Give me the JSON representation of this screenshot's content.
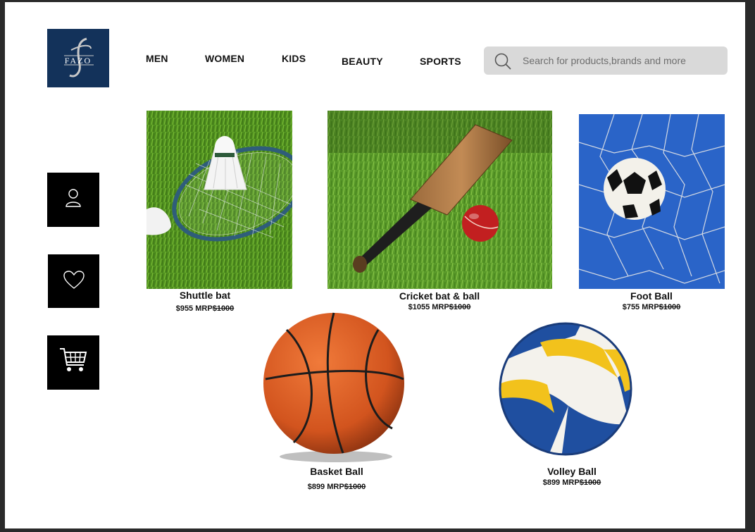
{
  "brand": {
    "logo_text": "FAZO",
    "logo_monogram": "J"
  },
  "nav": {
    "items": [
      {
        "label": "MEN"
      },
      {
        "label": "WOMEN"
      },
      {
        "label": "KIDS"
      },
      {
        "label": "BEAUTY"
      },
      {
        "label": "SPORTS"
      }
    ]
  },
  "search": {
    "placeholder": "Search for products,brands and more",
    "value": "",
    "icon": "search-icon"
  },
  "sidebar": {
    "items": [
      {
        "icon": "user-icon"
      },
      {
        "icon": "heart-icon"
      },
      {
        "icon": "cart-icon"
      }
    ]
  },
  "products": [
    {
      "name": "Shuttle bat",
      "price": "$955",
      "mrp_label": "MRP",
      "mrp": "$1000"
    },
    {
      "name": "Cricket bat & ball",
      "price": "$1055",
      "mrp_label": "MRP",
      "mrp": "$1000"
    },
    {
      "name": "Foot Ball",
      "price": "$755",
      "mrp_label": "MRP",
      "mrp": "$1000"
    },
    {
      "name": "Basket Ball",
      "price": "$899",
      "mrp_label": "MRP",
      "mrp": "$1000"
    },
    {
      "name": "Volley Ball",
      "price": "$899",
      "mrp_label": "MRP",
      "mrp": "$1000"
    }
  ],
  "colors": {
    "logo_bg": "#13325a",
    "search_bg": "#d9d9d9",
    "side_button_bg": "#000000",
    "page_bg": "#ffffff",
    "frame_bg": "#2a2a2a"
  }
}
